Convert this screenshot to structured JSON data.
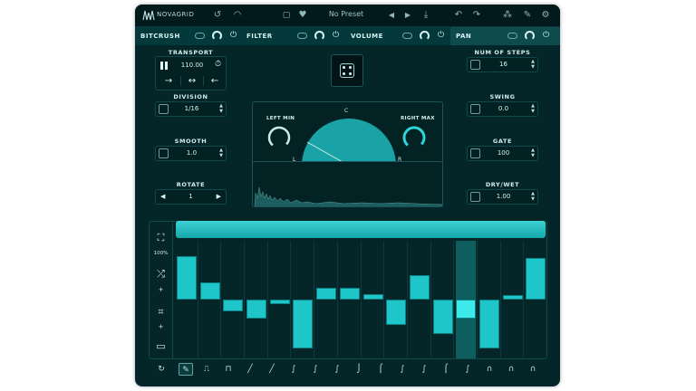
{
  "app": {
    "brand": "NOVAGRID",
    "preset": "No Preset"
  },
  "fx": [
    {
      "label": "BITCRUSH",
      "active": false
    },
    {
      "label": "FILTER",
      "active": false
    },
    {
      "label": "VOLUME",
      "active": false
    },
    {
      "label": "PAN",
      "active": true
    }
  ],
  "transport": {
    "label": "TRANSPORT",
    "bpm": "110.00",
    "directions": [
      "→",
      "↔",
      "←"
    ]
  },
  "division": {
    "label": "DIVISION",
    "value": "1/16"
  },
  "smooth": {
    "label": "SMOOTH",
    "value": "1.0"
  },
  "rotate": {
    "label": "ROTATE",
    "value": "1"
  },
  "num_steps": {
    "label": "NUM OF STEPS",
    "value": "16"
  },
  "swing": {
    "label": "SWING",
    "value": "0.0"
  },
  "gate": {
    "label": "GATE",
    "value": "100"
  },
  "drywet": {
    "label": "DRY/WET",
    "value": "1.00"
  },
  "pan": {
    "left_min": "LEFT MIN",
    "right_max": "RIGHT MAX",
    "center": "C",
    "left": "L",
    "right": "R"
  },
  "sequencer": {
    "zoom": "100%",
    "steps": [
      0.82,
      0.32,
      -0.22,
      -0.35,
      -0.08,
      -0.92,
      0.22,
      0.22,
      0.1,
      -0.48,
      0.45,
      -0.65,
      -0.36,
      -0.92,
      0.08,
      0.78
    ],
    "highlight_step": 12,
    "colors": {
      "bar": "#1fc6c9",
      "bar_selected": "#3ee9ec",
      "accent": "#14a9ab"
    }
  }
}
